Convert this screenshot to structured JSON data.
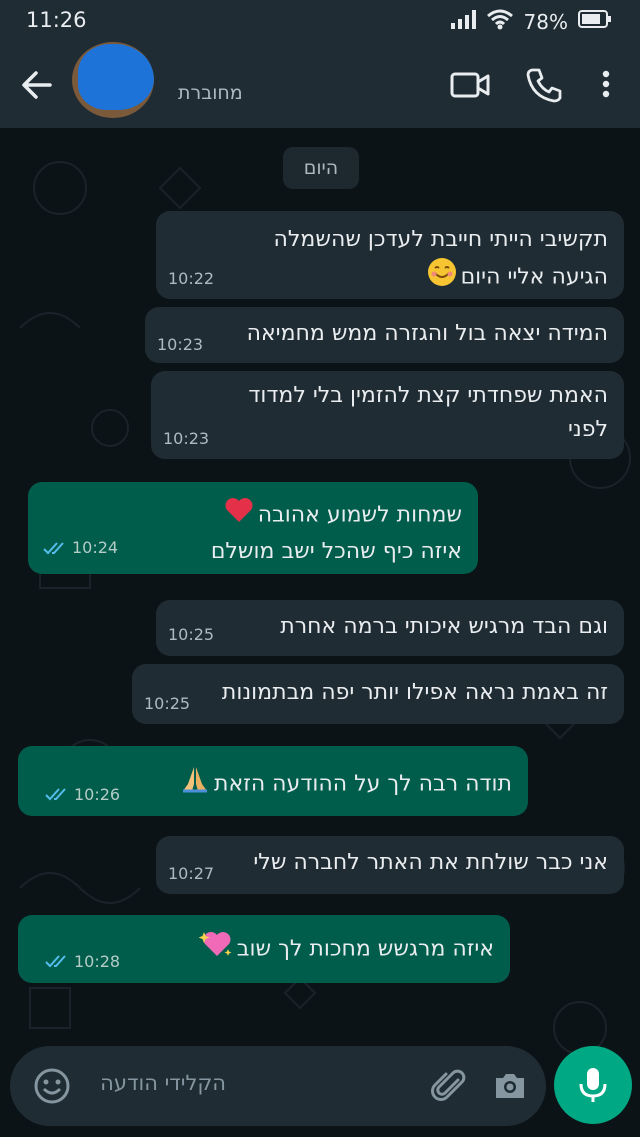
{
  "status_bar": {
    "time": "11:26",
    "battery": "78%"
  },
  "header": {
    "contact_status": "מחוברת",
    "icons": [
      "back-arrow-icon",
      "video-call-icon",
      "phone-icon",
      "more-vert-icon"
    ]
  },
  "date_chip": "היום",
  "messages": [
    {
      "dir": "in",
      "lines": [
        "תקשיבי הייתי חייבת לעדכן שהשמלה",
        "הגיעה אליי היום"
      ],
      "emoji": "smiling-face-icon",
      "time": "10:22"
    },
    {
      "dir": "in",
      "lines": [
        "המידה יצאה בול והגזרה ממש מחמיאה"
      ],
      "time": "10:23"
    },
    {
      "dir": "in",
      "lines": [
        "האמת שפחדתי קצת להזמין בלי למדוד",
        "לפני"
      ],
      "time": "10:23"
    },
    {
      "dir": "out",
      "lines": [
        "שמחות לשמוע אהובה",
        "איזה כיף שהכל ישב מושלם"
      ],
      "emoji": "red-heart-icon",
      "time": "10:24"
    },
    {
      "dir": "in",
      "lines": [
        "וגם הבד מרגיש איכותי ברמה אחרת"
      ],
      "time": "10:25"
    },
    {
      "dir": "in",
      "lines": [
        "זה באמת נראה אפילו יותר יפה מבתמונות"
      ],
      "time": "10:25"
    },
    {
      "dir": "out",
      "lines": [
        "תודה רבה לך על ההודעה הזאת"
      ],
      "emoji": "folded-hands-icon",
      "time": "10:26"
    },
    {
      "dir": "in",
      "lines": [
        "אני כבר שולחת את האתר לחברה שלי"
      ],
      "time": "10:27"
    },
    {
      "dir": "out",
      "lines": [
        "איזה מרגשש מחכות לך שוב"
      ],
      "emoji": "sparkling-heart-icon",
      "time": "10:28"
    }
  ],
  "composer": {
    "placeholder": "הקלידי הודעה",
    "icons": [
      "emoji-icon",
      "attach-icon",
      "camera-icon",
      "mic-icon"
    ]
  },
  "colors": {
    "incoming_bubble": "#202c33",
    "outgoing_bubble": "#005c4b",
    "accent": "#00a884",
    "read_ticks": "#53bdeb"
  }
}
